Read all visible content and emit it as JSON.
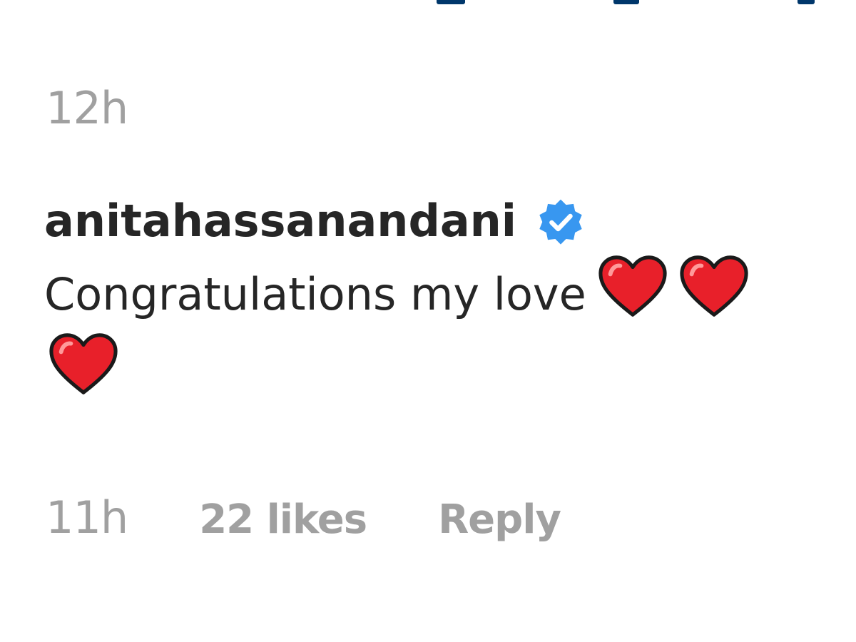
{
  "previous_comment": {
    "timestamp": "12h"
  },
  "comment": {
    "username": "anitahassanandani",
    "verified_icon": "verified-badge-icon",
    "text": "Congratulations my love",
    "emoji": [
      "red-heart-icon",
      "red-heart-icon",
      "red-heart-icon"
    ],
    "timestamp": "11h",
    "likes": "22 likes",
    "reply_label": "Reply"
  },
  "colors": {
    "username": "#262626",
    "body_text": "#262626",
    "muted_text": "#a0a0a0",
    "verified_blue": "#3897f0",
    "heart_red": "#e8202a",
    "link_blue": "#00376b"
  }
}
